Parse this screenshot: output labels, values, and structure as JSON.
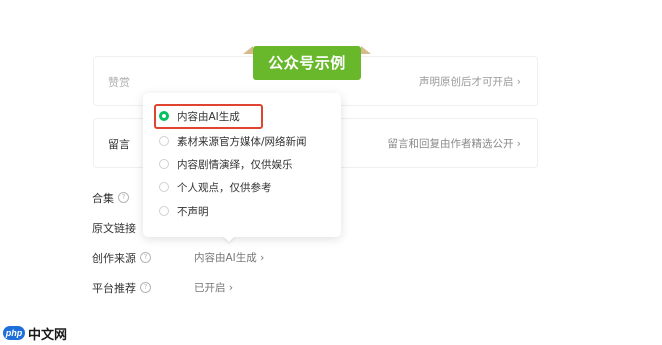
{
  "banner": {
    "title": "公众号示例"
  },
  "cards": {
    "appreciation": {
      "label": "赞赏",
      "right": "声明原创后才可开启 ›"
    },
    "comments": {
      "label": "留言",
      "right": "留言和回复由作者精选公开 ›"
    }
  },
  "popover": {
    "options": [
      {
        "label": "内容由AI生成",
        "checked": true
      },
      {
        "label": "素材来源官方媒体/网络新闻",
        "checked": false
      },
      {
        "label": "内容剧情演绎，仅供娱乐",
        "checked": false
      },
      {
        "label": "个人观点，仅供参考",
        "checked": false
      },
      {
        "label": "不声明",
        "checked": false
      }
    ]
  },
  "settings": {
    "collection": {
      "label": "合集",
      "help": "?"
    },
    "original_link": {
      "label": "原文链接"
    },
    "source": {
      "label": "创作来源",
      "help": "?",
      "value": "内容由AI生成 ›"
    },
    "recommend": {
      "label": "平台推荐",
      "help": "?",
      "value": "已开启 ›"
    }
  },
  "watermark": {
    "logo": "php",
    "text": "中文网"
  },
  "colors": {
    "accent_green": "#07c160",
    "banner_green": "#69b82b",
    "highlight_red": "#e0432f"
  }
}
